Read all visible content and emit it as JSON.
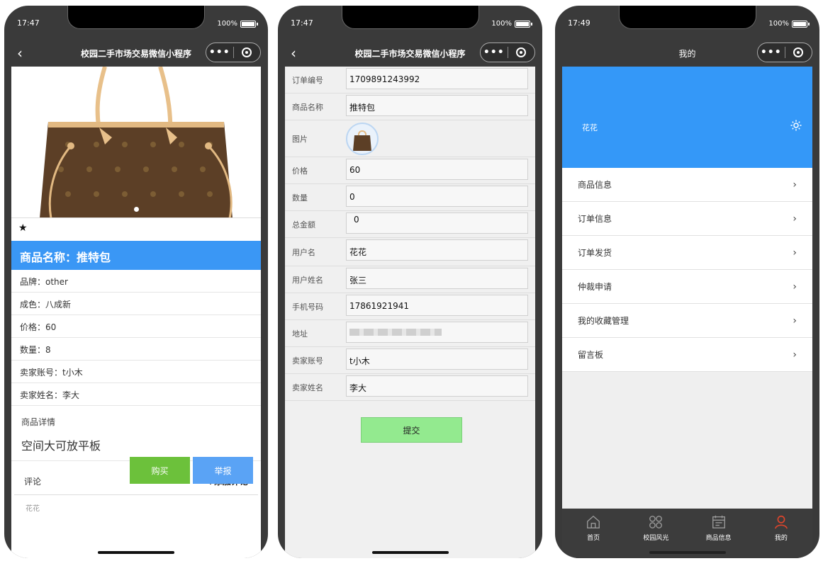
{
  "phone1": {
    "time": "17:47",
    "battery": "100%",
    "title": "校园二手市场交易微信小程序",
    "star": "★",
    "product_name": "商品名称：推特包",
    "info": [
      "品牌：other",
      "成色：八成新",
      "价格：60",
      "数量：8",
      "卖家账号：t小木",
      "卖家姓名：李大"
    ],
    "detail_label": "商品详情",
    "detail_text": "空间大可放平板",
    "comment_label": "评论",
    "comment_add": "+添加评论",
    "comment_user": "花花",
    "buy_label": "购买",
    "report_label": "举报"
  },
  "phone2": {
    "time": "17:47",
    "battery": "100%",
    "title": "校园二手市场交易微信小程序",
    "fields": [
      {
        "label": "订单编号",
        "value": "1709891243992"
      },
      {
        "label": "商品名称",
        "value": "推特包"
      },
      {
        "label": "图片",
        "value": ""
      },
      {
        "label": "价格",
        "value": "60"
      },
      {
        "label": "数量",
        "value": "0"
      },
      {
        "label": "总金额",
        "value": "0"
      },
      {
        "label": "用户名",
        "value": "花花"
      },
      {
        "label": "用户姓名",
        "value": "张三"
      },
      {
        "label": "手机号码",
        "value": "17861921941"
      },
      {
        "label": "地址",
        "value": ""
      },
      {
        "label": "卖家账号",
        "value": "t小木"
      },
      {
        "label": "卖家姓名",
        "value": "李大"
      }
    ],
    "submit_label": "提交"
  },
  "phone3": {
    "time": "17:49",
    "battery": "100%",
    "title": "我的",
    "username": "花花",
    "menu": [
      "商品信息",
      "订单信息",
      "订单发货",
      "仲裁申请",
      "我的收藏管理",
      "留言板"
    ],
    "tabs": [
      {
        "label": "首页",
        "icon": "home-icon"
      },
      {
        "label": "校园风光",
        "icon": "grid-icon"
      },
      {
        "label": "商品信息",
        "icon": "calendar-icon"
      },
      {
        "label": "我的",
        "icon": "user-icon"
      }
    ],
    "accent": "#3498f8"
  }
}
